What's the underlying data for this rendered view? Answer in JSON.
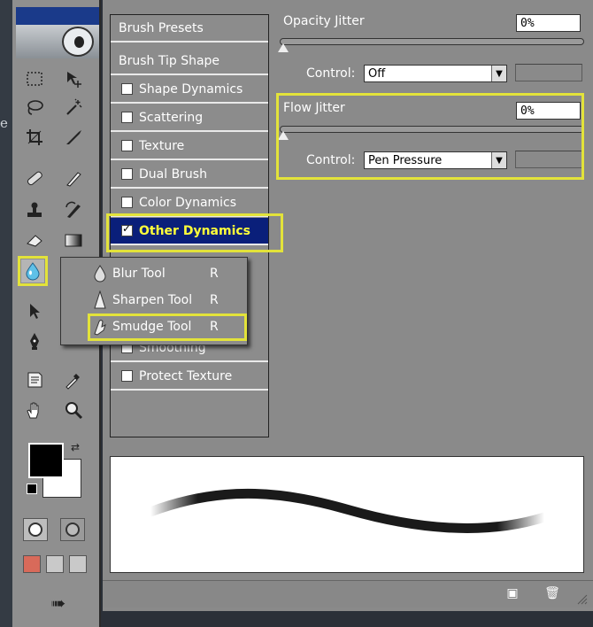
{
  "left_edge_text": "e",
  "toolbox": {
    "tools": [
      {
        "name": "marquee-tool",
        "glyph": "⬚"
      },
      {
        "name": "move-tool",
        "glyph": "✥"
      },
      {
        "name": "lasso-tool",
        "glyph": "⌇"
      },
      {
        "name": "magic-wand-tool",
        "glyph": "✳"
      },
      {
        "name": "crop-tool",
        "glyph": "⌗"
      },
      {
        "name": "slice-tool",
        "glyph": "⟋"
      },
      {
        "name": "healing-brush-tool",
        "glyph": "✚"
      },
      {
        "name": "brush-tool",
        "glyph": "✎"
      },
      {
        "name": "clone-stamp-tool",
        "glyph": "⊥"
      },
      {
        "name": "history-brush-tool",
        "glyph": "↺"
      },
      {
        "name": "eraser-tool",
        "glyph": "▱"
      },
      {
        "name": "gradient-tool",
        "glyph": "▤"
      },
      {
        "name": "blur-tool",
        "glyph": "💧"
      },
      {
        "name": "path-selection-tool",
        "glyph": "➤"
      },
      {
        "name": "pen-tool",
        "glyph": "✒"
      },
      {
        "name": "notes-tool",
        "glyph": "▤"
      },
      {
        "name": "eyedropper-tool",
        "glyph": "⟋"
      },
      {
        "name": "hand-tool",
        "glyph": "✋"
      },
      {
        "name": "zoom-tool",
        "glyph": "🔍"
      }
    ]
  },
  "flyout": {
    "items": [
      {
        "label": "Blur Tool",
        "shortcut": "R",
        "icon": "blur-drop-icon"
      },
      {
        "label": "Sharpen Tool",
        "shortcut": "R",
        "icon": "sharpen-cone-icon"
      },
      {
        "label": "Smudge Tool",
        "shortcut": "R",
        "icon": "smudge-finger-icon"
      }
    ]
  },
  "brushes": {
    "nav": [
      {
        "label": "Brush Presets",
        "checkbox": false
      },
      {
        "label": "Brush Tip Shape",
        "checkbox": false
      },
      {
        "label": "Shape Dynamics",
        "checkbox": true,
        "checked": false
      },
      {
        "label": "Scattering",
        "checkbox": true,
        "checked": false
      },
      {
        "label": "Texture",
        "checkbox": true,
        "checked": false
      },
      {
        "label": "Dual Brush",
        "checkbox": true,
        "checked": false
      },
      {
        "label": "Color Dynamics",
        "checkbox": true,
        "checked": false
      },
      {
        "label": "Other Dynamics",
        "checkbox": true,
        "checked": true,
        "active": true
      }
    ],
    "nav_lower": [
      {
        "label": "Smoothing",
        "checkbox": true,
        "checked": false
      },
      {
        "label": "Protect Texture",
        "checkbox": true,
        "checked": false
      }
    ],
    "opacity_jitter": {
      "label": "Opacity Jitter",
      "value": "0%",
      "control_label": "Control:",
      "control_value": "Off"
    },
    "flow_jitter": {
      "label": "Flow Jitter",
      "value": "0%",
      "control_label": "Control:",
      "control_value": "Pen Pressure"
    }
  },
  "colors": {
    "highlight": "#e3e33a",
    "active_bg": "#0a1f7a",
    "active_text": "#ffff3a"
  }
}
